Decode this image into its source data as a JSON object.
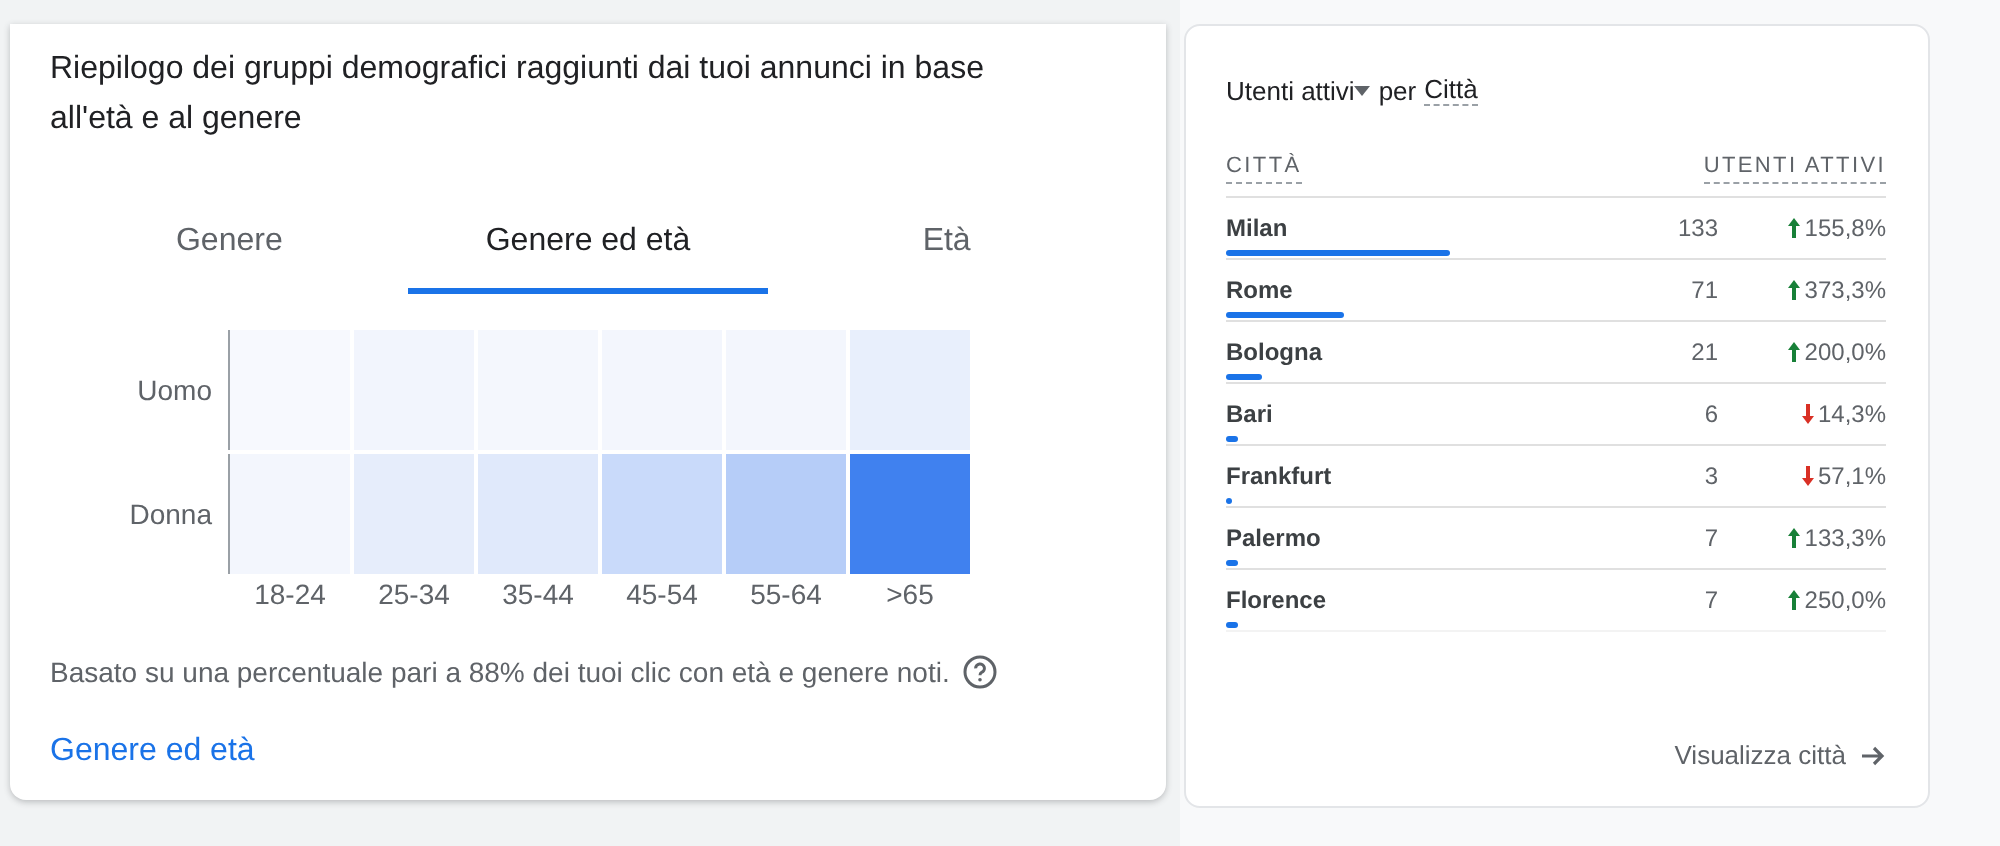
{
  "demographics": {
    "title": "Riepilogo dei gruppi demografici raggiunti dai tuoi annunci in base all'età e al genere",
    "tabs": [
      {
        "label": "Genere",
        "selected": false
      },
      {
        "label": "Genere ed età",
        "selected": true
      },
      {
        "label": "Età",
        "selected": false
      }
    ],
    "heatmap": {
      "rows": [
        {
          "label": "Uomo",
          "cells": [
            {
              "color": "#f7f9fe"
            },
            {
              "color": "#f2f5fd"
            },
            {
              "color": "#f4f7fd"
            },
            {
              "color": "#f3f6fd"
            },
            {
              "color": "#f3f6fd"
            },
            {
              "color": "#e8effc"
            }
          ]
        },
        {
          "label": "Donna",
          "cells": [
            {
              "color": "#f3f6fd"
            },
            {
              "color": "#e6edfb"
            },
            {
              "color": "#e0e9fb"
            },
            {
              "color": "#c9dafa"
            },
            {
              "color": "#b6cdf8"
            },
            {
              "color": "#4081ef"
            }
          ]
        }
      ],
      "columns": [
        "18-24",
        "25-34",
        "35-44",
        "45-54",
        "55-64",
        ">65"
      ]
    },
    "note": "Basato su una percentuale pari a 88% dei tuoi clic con età e genere noti.",
    "link": "Genere ed età"
  },
  "cities": {
    "metric": "Utenti attivi",
    "by": "per",
    "dimension": "Città",
    "columns": [
      "CITTÀ",
      "UTENTI ATTIVI"
    ],
    "rows": [
      {
        "city": "Milan",
        "users": "133",
        "change": "155,8%",
        "kind": "up",
        "level": 0.34
      },
      {
        "city": "Rome",
        "users": "71",
        "change": "373,3%",
        "kind": "up",
        "level": 0.18
      },
      {
        "city": "Bologna",
        "users": "21",
        "change": "200,0%",
        "kind": "up",
        "level": 0.055
      },
      {
        "city": "Bari",
        "users": "6",
        "change": "14,3%",
        "kind": "down",
        "level": 0.018
      },
      {
        "city": "Frankfurt",
        "users": "3",
        "change": "57,1%",
        "kind": "down",
        "level": 0.01
      },
      {
        "city": "Palermo",
        "users": "7",
        "change": "133,3%",
        "kind": "up",
        "level": 0.018
      },
      {
        "city": "Florence",
        "users": "7",
        "change": "250,0%",
        "kind": "up",
        "level": 0.018
      }
    ],
    "link": "Visualizza città"
  }
}
